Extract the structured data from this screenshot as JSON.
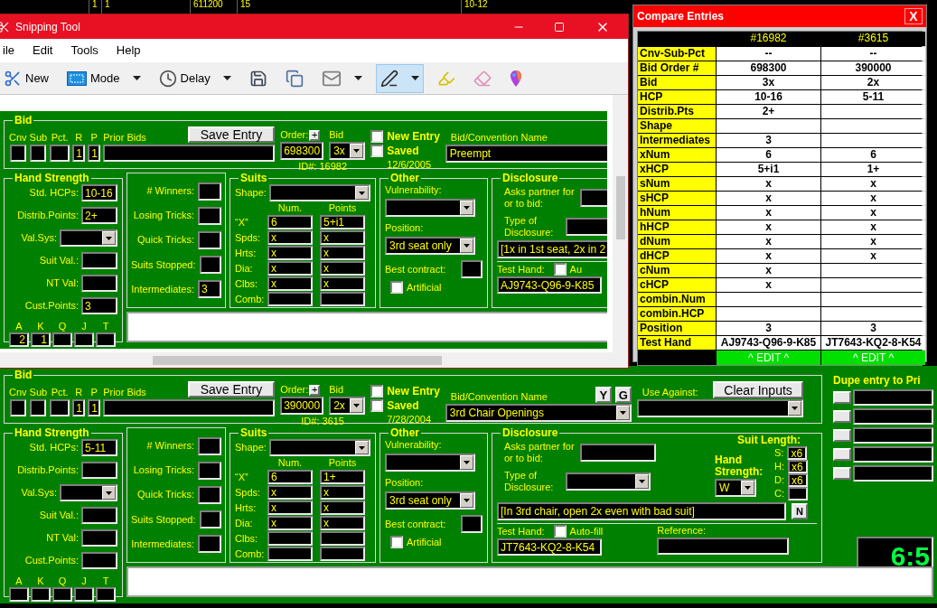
{
  "background_table": {
    "cells": [
      "1",
      "1",
      "611200",
      "15",
      "10-12"
    ]
  },
  "snipping_tool": {
    "title": "Snipping Tool",
    "menu": [
      "ile",
      "Edit",
      "Tools",
      "Help"
    ],
    "tools": [
      {
        "kind": "new",
        "label": "New"
      },
      {
        "kind": "mode",
        "label": "Mode",
        "menu": true
      },
      {
        "kind": "delay",
        "label": "Delay",
        "menu": true
      },
      {
        "kind": "save"
      },
      {
        "kind": "copy"
      },
      {
        "kind": "send",
        "menu": true
      },
      {
        "kind": "pen",
        "menu": true,
        "selected": true
      },
      {
        "kind": "highlighter",
        "selected": false
      },
      {
        "kind": "eraser",
        "selected": false
      },
      {
        "kind": "paint",
        "selected": false
      }
    ]
  },
  "captured_form": {
    "bid": {
      "title": "Bid",
      "labels": [
        "Cnv",
        "Sub",
        "Pct.",
        "R",
        "P",
        "Prior Bids"
      ],
      "r": "1",
      "p": "1",
      "save_button": "Save Entry",
      "order_label": "Order:",
      "order_plus": "+",
      "order": "698300",
      "bid_label": "Bid",
      "bid": "3x",
      "id": "ID#: 16982",
      "new_entry": {
        "label": "New Entry",
        "checked": false
      },
      "saved": {
        "label": "Saved",
        "checked": false
      },
      "date": "12/6/2005",
      "name_label": "Bid/Convention Name",
      "name": "Preempt"
    },
    "hand_strength": {
      "title": "Hand Strength",
      "rows": [
        {
          "label": "Std. HCPs:",
          "kind": "field",
          "value": "10-16"
        },
        {
          "label": "Distrib.Points:",
          "kind": "field",
          "value": "2+"
        },
        {
          "label": "Val.Sys:",
          "kind": "select"
        },
        {
          "label": "Suit Val.:",
          "kind": "field"
        },
        {
          "label": "NT Val:",
          "kind": "field"
        },
        {
          "label": "Cust.Points:",
          "kind": "field",
          "value": "3"
        }
      ],
      "honors": [
        {
          "label": "A",
          "value": "2"
        },
        {
          "label": "K",
          "value": "1"
        },
        {
          "label": "Q"
        },
        {
          "label": "J"
        },
        {
          "label": "T"
        }
      ]
    },
    "tricks": [
      {
        "label": "# Winners:"
      },
      {
        "label": "Losing Tricks:"
      },
      {
        "label": "Quick Tricks:"
      },
      {
        "label": "Suits Stopped:"
      },
      {
        "label": "Intermediates:",
        "value": "3"
      }
    ],
    "suits": {
      "title": "Suits",
      "shape_label": "Shape:",
      "num_label": "Num.",
      "points_label": "Points",
      "rows": [
        {
          "label": "“X”",
          "num": "6",
          "points": "5+i1"
        },
        {
          "label": "Spds:",
          "num": "x",
          "points": "x"
        },
        {
          "label": "Hrts:",
          "num": "x",
          "points": "x"
        },
        {
          "label": "Dia:",
          "num": "x",
          "points": "x"
        },
        {
          "label": "Clbs:",
          "num": "x",
          "points": "x"
        },
        {
          "label": "Comb:"
        }
      ]
    },
    "other": {
      "title": "Other",
      "vulnerability_label": "Vulnerability:",
      "position_label": "Position:",
      "position": "3rd seat only",
      "best_contract_label": "Best contract:",
      "artificial": {
        "label": "Artificial",
        "checked": false
      }
    },
    "disclosure": {
      "title": "Disclosure",
      "asks_label": "Asks partner for or to bid:",
      "type_label": "Type of Disclosure:",
      "text": "[1x in 1st seat, 2x in 2",
      "test_hand_label": "Test Hand:",
      "auto_fill": {
        "label": "Au",
        "checked": false
      },
      "test_hand": "AJ9743-Q96-9-K85"
    }
  },
  "compare": {
    "title": "Compare Entries",
    "close": "X",
    "columns": [
      "#16982",
      "#3615"
    ],
    "rows": [
      {
        "label": "Cnv-Sub-Pct",
        "entry_1": "--",
        "entry_2": "--"
      },
      {
        "label": "Bid Order #",
        "entry_1": "698300",
        "entry_2": "390000"
      },
      {
        "label": "Bid",
        "entry_1": "3x",
        "entry_2": "2x"
      },
      {
        "label": "HCP",
        "entry_1": "10-16",
        "entry_2": "5-11"
      },
      {
        "label": "Distrib.Pts",
        "entry_1": "2+"
      },
      {
        "label": "Shape"
      },
      {
        "label": "Intermediates",
        "entry_1": "3"
      },
      {
        "label": "xNum",
        "entry_1": "6",
        "entry_2": "6"
      },
      {
        "label": "xHCP",
        "entry_1": "5+i1",
        "entry_2": "1+"
      },
      {
        "label": "sNum",
        "entry_1": "x",
        "entry_2": "x"
      },
      {
        "label": "sHCP",
        "entry_1": "x",
        "entry_2": "x"
      },
      {
        "label": "hNum",
        "entry_1": "x",
        "entry_2": "x"
      },
      {
        "label": "hHCP",
        "entry_1": "x",
        "entry_2": "x"
      },
      {
        "label": "dNum",
        "entry_1": "x",
        "entry_2": "x"
      },
      {
        "label": "dHCP",
        "entry_1": "x",
        "entry_2": "x"
      },
      {
        "label": "cNum",
        "entry_1": "x"
      },
      {
        "label": "cHCP",
        "entry_1": "x"
      },
      {
        "label": "combin.Num"
      },
      {
        "label": "combin.HCP"
      },
      {
        "label": "Position",
        "entry_1": "3",
        "entry_2": "3"
      },
      {
        "label": "Test Hand",
        "entry_1": "AJ9743-Q96-9-K85",
        "entry_2": "JT7643-KQ2-8-K54"
      }
    ],
    "edit_buttons": [
      "^ EDIT ^",
      "^ EDIT ^"
    ]
  },
  "entry_form": {
    "bid": {
      "title": "Bid",
      "labels": [
        "Cnv",
        "Sub",
        "Pct.",
        "R",
        "P",
        "Prior Bids"
      ],
      "r": "1",
      "p": "1",
      "save_button": "Save Entry",
      "order_label": "Order:",
      "order_plus": "+",
      "order": "390000",
      "bid_label": "Bid",
      "bid": "2x",
      "id": "ID#: 3615",
      "new_entry": {
        "label": "New Entry",
        "checked": false
      },
      "saved": {
        "label": "Saved",
        "checked": false
      },
      "date": "7/28/2004",
      "name_label": "Bid/Convention Name",
      "name": "3rd Chair Openings",
      "y_button": "Y",
      "g_button": "G",
      "use_against_label": "Use Against:",
      "clear_button": "Clear Inputs"
    },
    "hand_strength": {
      "title": "Hand Strength",
      "rows": [
        {
          "label": "Std. HCPs:",
          "kind": "field",
          "value": "5-11"
        },
        {
          "label": "Distrib.Points:",
          "kind": "field"
        },
        {
          "label": "Val.Sys:",
          "kind": "select"
        },
        {
          "label": "Suit Val.:",
          "kind": "field"
        },
        {
          "label": "NT Val:",
          "kind": "field"
        },
        {
          "label": "Cust.Points:",
          "kind": "field"
        }
      ],
      "honors": [
        {
          "label": "A"
        },
        {
          "label": "K"
        },
        {
          "label": "Q"
        },
        {
          "label": "J"
        },
        {
          "label": "T"
        }
      ]
    },
    "tricks": [
      {
        "label": "# Winners:"
      },
      {
        "label": "Losing Tricks:"
      },
      {
        "label": "Quick Tricks:"
      },
      {
        "label": "Suits Stopped:"
      },
      {
        "label": "Intermediates:"
      }
    ],
    "suits": {
      "title": "Suits",
      "shape_label": "Shape:",
      "num_label": "Num.",
      "points_label": "Points",
      "rows": [
        {
          "label": "“X”",
          "num": "6",
          "points": "1+"
        },
        {
          "label": "Spds:",
          "num": "x",
          "points": "x"
        },
        {
          "label": "Hrts:",
          "num": "x",
          "points": "x"
        },
        {
          "label": "Dia:",
          "num": "x",
          "points": "x"
        },
        {
          "label": "Clbs:"
        },
        {
          "label": "Comb:"
        }
      ]
    },
    "other": {
      "title": "Other",
      "vulnerability_label": "Vulnerability:",
      "position_label": "Position:",
      "position": "3rd seat only",
      "best_contract_label": "Best contract:",
      "artificial": {
        "label": "Artificial",
        "checked": false
      }
    },
    "disclosure": {
      "title": "Disclosure",
      "asks_label": "Asks partner for or to bid:",
      "type_label": "Type of Disclosure:",
      "suit_length": {
        "title": "Suit Length:",
        "rows": [
          {
            "label": "S:",
            "value": "x6"
          },
          {
            "label": "H:",
            "value": "x6"
          },
          {
            "label": "D:",
            "value": "x6"
          },
          {
            "label": "C:"
          }
        ]
      },
      "strength": {
        "label": "Hand Strength:",
        "value": "W"
      },
      "text": "[In 3rd chair, open 2x even with bad suit]",
      "n_button": "N",
      "test_hand_label": "Test Hand:",
      "auto_fill": {
        "label": "Auto-fill",
        "checked": false
      },
      "test_hand": "JT7643-KQ2-8-K54",
      "reference_label": "Reference:"
    },
    "dupe": {
      "title": "Dupe entry to Pri",
      "clock": "6:5"
    }
  }
}
